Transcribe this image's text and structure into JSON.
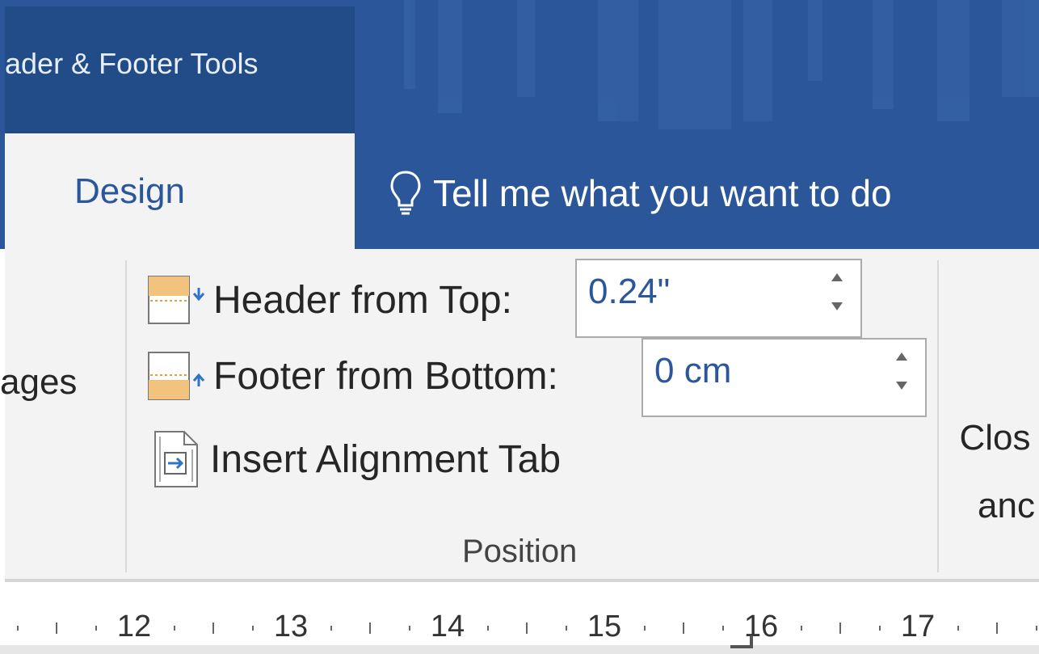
{
  "titlebar": {
    "context_title": "ader & Footer Tools"
  },
  "tabs": {
    "design": "Design",
    "tell_me": "Tell me what you want to do"
  },
  "ribbon": {
    "pages_label": "ages",
    "header_from_top": {
      "label": "Header from Top:",
      "value": "0.24\""
    },
    "footer_from_bottom": {
      "label": "Footer from Bottom:",
      "value": "0 cm"
    },
    "insert_alignment_tab": "Insert Alignment Tab",
    "group_label": "Position",
    "close_label_line1": "Clos",
    "close_label_line2": "anc"
  },
  "ruler": {
    "numbers": [
      "12",
      "13",
      "14",
      "15",
      "16",
      "17"
    ]
  },
  "colors": {
    "accent": "#2b579a",
    "context_band": "#224c87",
    "ribbon_bg": "#f3f3f3"
  },
  "icons": {
    "tell_me": "lightbulb-icon",
    "header_from_top": "header-from-top-icon",
    "footer_from_bottom": "footer-from-bottom-icon",
    "insert_alignment_tab": "insert-alignment-tab-icon"
  }
}
